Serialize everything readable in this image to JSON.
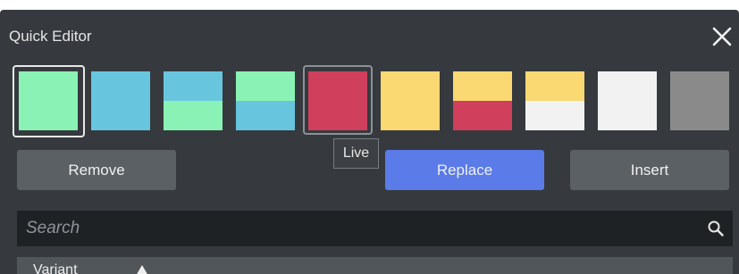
{
  "window": {
    "title": "Quick Editor",
    "close_icon": "close-icon"
  },
  "swatches": [
    {
      "name": "mint",
      "top": "#8af2b4",
      "bottom": "#8af2b4",
      "selected": true
    },
    {
      "name": "sky",
      "top": "#67c6dd",
      "bottom": "#67c6dd"
    },
    {
      "name": "sky-over-mint",
      "top": "#67c6dd",
      "bottom": "#8af2b4"
    },
    {
      "name": "mint-over-sky",
      "top": "#8af2b4",
      "bottom": "#67c6dd"
    },
    {
      "name": "live",
      "top": "#d03f5c",
      "bottom": "#d03f5c",
      "hovered": true,
      "tooltip": "Live"
    },
    {
      "name": "yellow",
      "top": "#fad872",
      "bottom": "#fad872"
    },
    {
      "name": "yellow-over-red",
      "top": "#fad872",
      "bottom": "#d03f5c"
    },
    {
      "name": "yellow-over-white",
      "top": "#fad872",
      "bottom": "#f2f2f2"
    },
    {
      "name": "white",
      "top": "#f2f2f2",
      "bottom": "#f2f2f2"
    },
    {
      "name": "gray",
      "top": "#8a8a8a",
      "bottom": "#8a8a8a"
    }
  ],
  "tooltip": {
    "text": "Live"
  },
  "buttons": {
    "remove": "Remove",
    "replace": "Replace",
    "insert": "Insert"
  },
  "search": {
    "placeholder": "Search",
    "value": "",
    "icon": "search-icon"
  },
  "table": {
    "column": "Variant",
    "sort_icon": "sort-ascending-icon"
  },
  "colors": {
    "panel": "#363a3f",
    "accent": "#5a7be8",
    "button": "#5b6064"
  }
}
